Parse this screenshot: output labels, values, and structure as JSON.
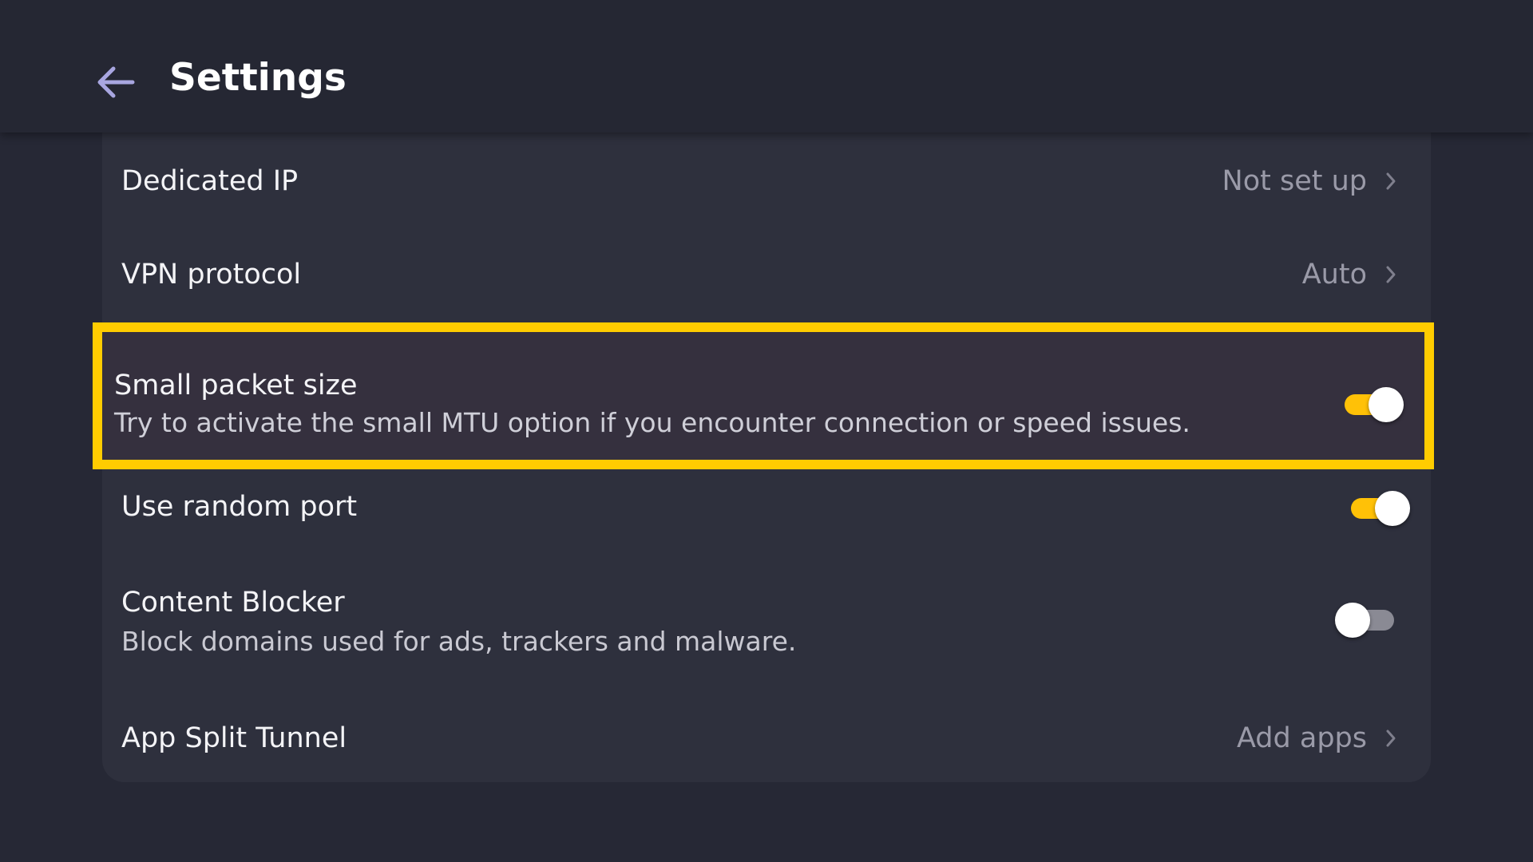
{
  "header": {
    "title": "Settings",
    "back_icon": "arrow-left-icon"
  },
  "colors": {
    "background": "#262835",
    "card": "#2e303d",
    "accent": "#ffc107",
    "highlight_border": "#ffcc00",
    "back_arrow": "#a8a6e0"
  },
  "settings": {
    "dedicated_ip": {
      "label": "Dedicated IP",
      "value": "Not set up"
    },
    "vpn_protocol": {
      "label": "VPN protocol",
      "value": "Auto"
    },
    "small_packet": {
      "label": "Small packet size",
      "description": "Try to activate the small MTU option if you encounter connection or speed issues.",
      "enabled": true
    },
    "random_port": {
      "label": "Use random port",
      "enabled": true
    },
    "content_blocker": {
      "label": "Content Blocker",
      "description": "Block domains used for ads, trackers and malware.",
      "enabled": false
    },
    "split_tunnel": {
      "label": "App Split Tunnel",
      "value": "Add apps"
    }
  }
}
